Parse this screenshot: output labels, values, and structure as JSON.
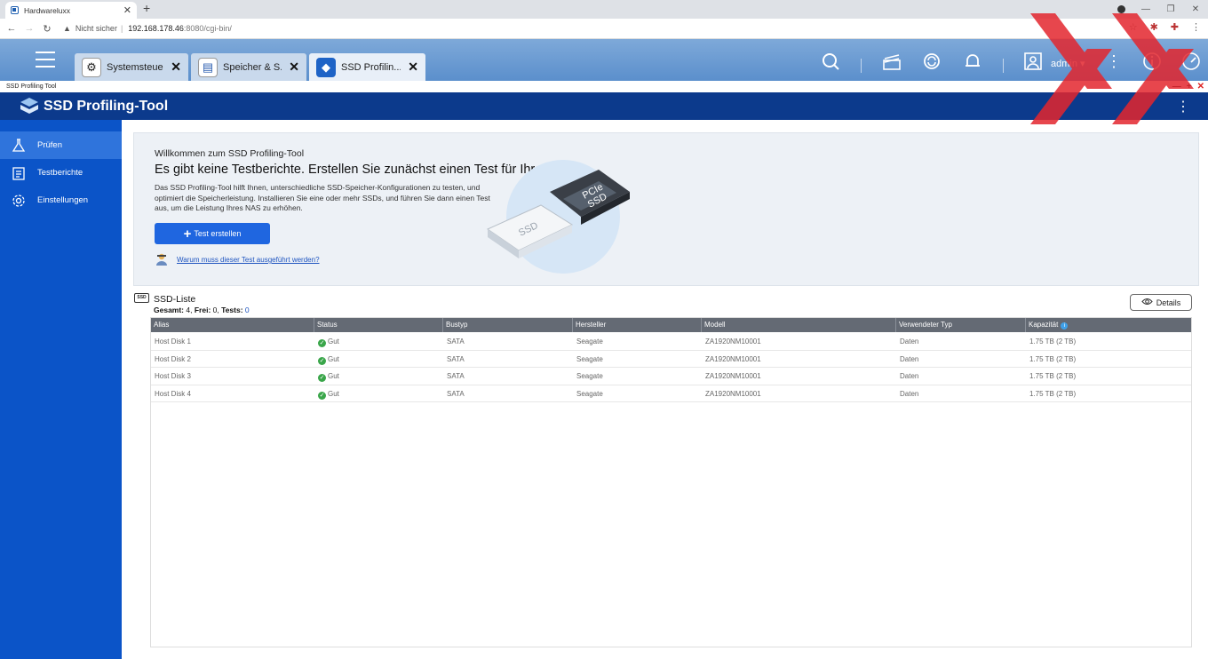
{
  "browser": {
    "tab_title": "Hardwareluxx",
    "not_secure": "Nicht sicher",
    "url_host": "192.168.178.46",
    "url_path": ":8080/cgi-bin/"
  },
  "desktop": {
    "tabs": [
      {
        "label": "Systemsteue..."
      },
      {
        "label": "Speicher & S..."
      },
      {
        "label": "SSD Profilin..."
      }
    ],
    "user": "admin"
  },
  "app": {
    "window_title": "SSD Profiling Tool",
    "name": "SSD Profiling-Tool"
  },
  "sidebar": {
    "items": [
      {
        "label": "Prüfen"
      },
      {
        "label": "Testberichte"
      },
      {
        "label": "Einstellungen"
      }
    ]
  },
  "welcome": {
    "subtitle": "Willkommen zum SSD Profiling-Tool",
    "title": "Es gibt keine Testberichte. Erstellen Sie zunächst einen Test für Ihre SSDs.",
    "description": "Das SSD Profiling-Tool hilft Ihnen, unterschiedliche SSD-Speicher-Konfigurationen zu testen, und optimiert die Speicherleistung. Installieren Sie eine oder mehr SSDs, und führen Sie dann einen Test aus, um die Leistung Ihres NAS zu erhöhen.",
    "create_button": "Test erstellen",
    "why_link": "Warum muss dieser Test ausgeführt werden?",
    "illus_ssd": "SSD",
    "illus_pcie": "PCIe",
    "illus_pcie_ssd": "SSD"
  },
  "ssd_list": {
    "icon_text": "SSD",
    "title": "SSD-Liste",
    "summary_label_total": "Gesamt:",
    "total": "4",
    "summary_label_free": "Frei:",
    "free": "0",
    "summary_label_tests": "Tests:",
    "tests": "0",
    "details_button": "Details",
    "columns": [
      "Alias",
      "Status",
      "Bustyp",
      "Hersteller",
      "Modell",
      "Verwendeter Typ",
      "Kapazität"
    ],
    "rows": [
      {
        "alias": "Host Disk 1",
        "status": "Gut",
        "bus": "SATA",
        "vendor": "Seagate",
        "model": "ZA1920NM10001",
        "type": "Daten",
        "capacity": "1.75 TB (2 TB)"
      },
      {
        "alias": "Host Disk 2",
        "status": "Gut",
        "bus": "SATA",
        "vendor": "Seagate",
        "model": "ZA1920NM10001",
        "type": "Daten",
        "capacity": "1.75 TB (2 TB)"
      },
      {
        "alias": "Host Disk 3",
        "status": "Gut",
        "bus": "SATA",
        "vendor": "Seagate",
        "model": "ZA1920NM10001",
        "type": "Daten",
        "capacity": "1.75 TB (2 TB)"
      },
      {
        "alias": "Host Disk 4",
        "status": "Gut",
        "bus": "SATA",
        "vendor": "Seagate",
        "model": "ZA1920NM10001",
        "type": "Daten",
        "capacity": "1.75 TB (2 TB)"
      }
    ]
  },
  "colors": {
    "sidebar": "#0b54c8",
    "app_header": "#0c3a8c",
    "accent_button": "#1f66e0",
    "status_ok": "#3aa64a"
  },
  "icons": {
    "sidebar": [
      "flask-icon",
      "report-icon",
      "gear-icon"
    ],
    "header": [
      "search-icon",
      "stack-icon",
      "sync-icon",
      "bell-icon",
      "user-icon",
      "more-icon",
      "info-icon",
      "dashboard-icon"
    ]
  }
}
